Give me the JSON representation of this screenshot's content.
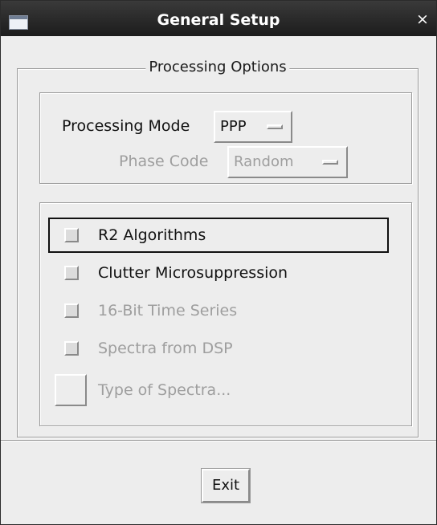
{
  "window": {
    "title": "General Setup",
    "close_glyph": "×",
    "icon": "window-menu-icon"
  },
  "processing_options": {
    "legend": "Processing Options",
    "processing_mode": {
      "label": "Processing Mode",
      "value": "PPP"
    },
    "phase_code": {
      "label": "Phase Code",
      "value": "Random",
      "disabled": true
    },
    "checkboxes": [
      {
        "label": "R2 Algorithms",
        "checked": false,
        "disabled": false,
        "focused": true
      },
      {
        "label": "Clutter Microsuppression",
        "checked": false,
        "disabled": false
      },
      {
        "label": "16-Bit Time Series",
        "checked": false,
        "disabled": true
      },
      {
        "label": "Spectra from DSP",
        "checked": false,
        "disabled": true
      }
    ],
    "type_of_spectra": {
      "label": "Type of Spectra...",
      "disabled": true
    }
  },
  "footer": {
    "exit_label": "Exit"
  }
}
